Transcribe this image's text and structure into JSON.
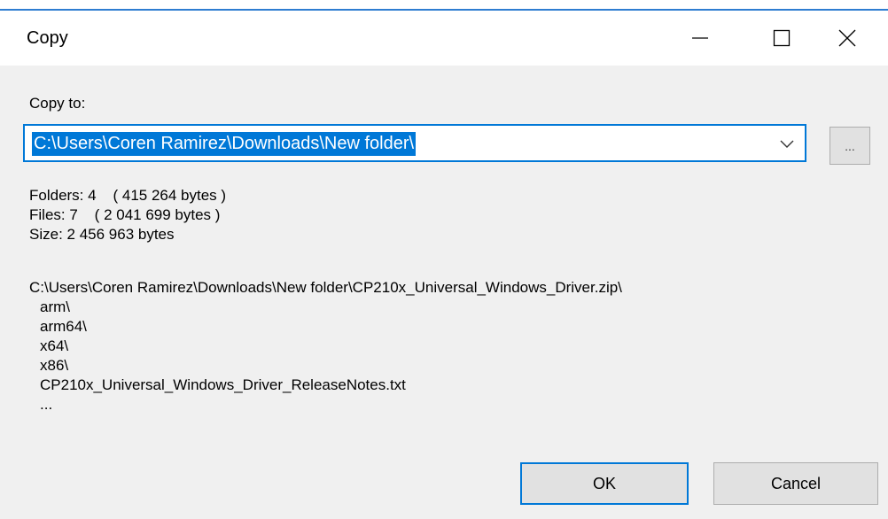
{
  "dialog": {
    "title": "Copy",
    "copy_to_label": "Copy to:",
    "destination_value": "C:\\Users\\Coren Ramirez\\Downloads\\New folder\\",
    "browse_label": "...",
    "stats": {
      "folders": "Folders: 4    ( 415 264 bytes )",
      "files": "Files: 7    ( 2 041 699 bytes )",
      "size": "Size: 2 456 963 bytes"
    },
    "listing": {
      "path": "C:\\Users\\Coren Ramirez\\Downloads\\New folder\\CP210x_Universal_Windows_Driver.zip\\",
      "items": [
        "arm\\",
        "arm64\\",
        "x64\\",
        "x86\\",
        "CP210x_Universal_Windows_Driver_ReleaseNotes.txt",
        "..."
      ]
    },
    "ok_label": "OK",
    "cancel_label": "Cancel"
  },
  "icons": {
    "minimize": "minimize-icon",
    "maximize": "maximize-icon",
    "close": "close-icon",
    "dropdown": "chevron-down-icon"
  },
  "colors": {
    "accent": "#0078d7",
    "window_border": "#2e7dd1",
    "dialog_bg": "#f0f0f0",
    "button_bg": "#e1e1e1"
  }
}
